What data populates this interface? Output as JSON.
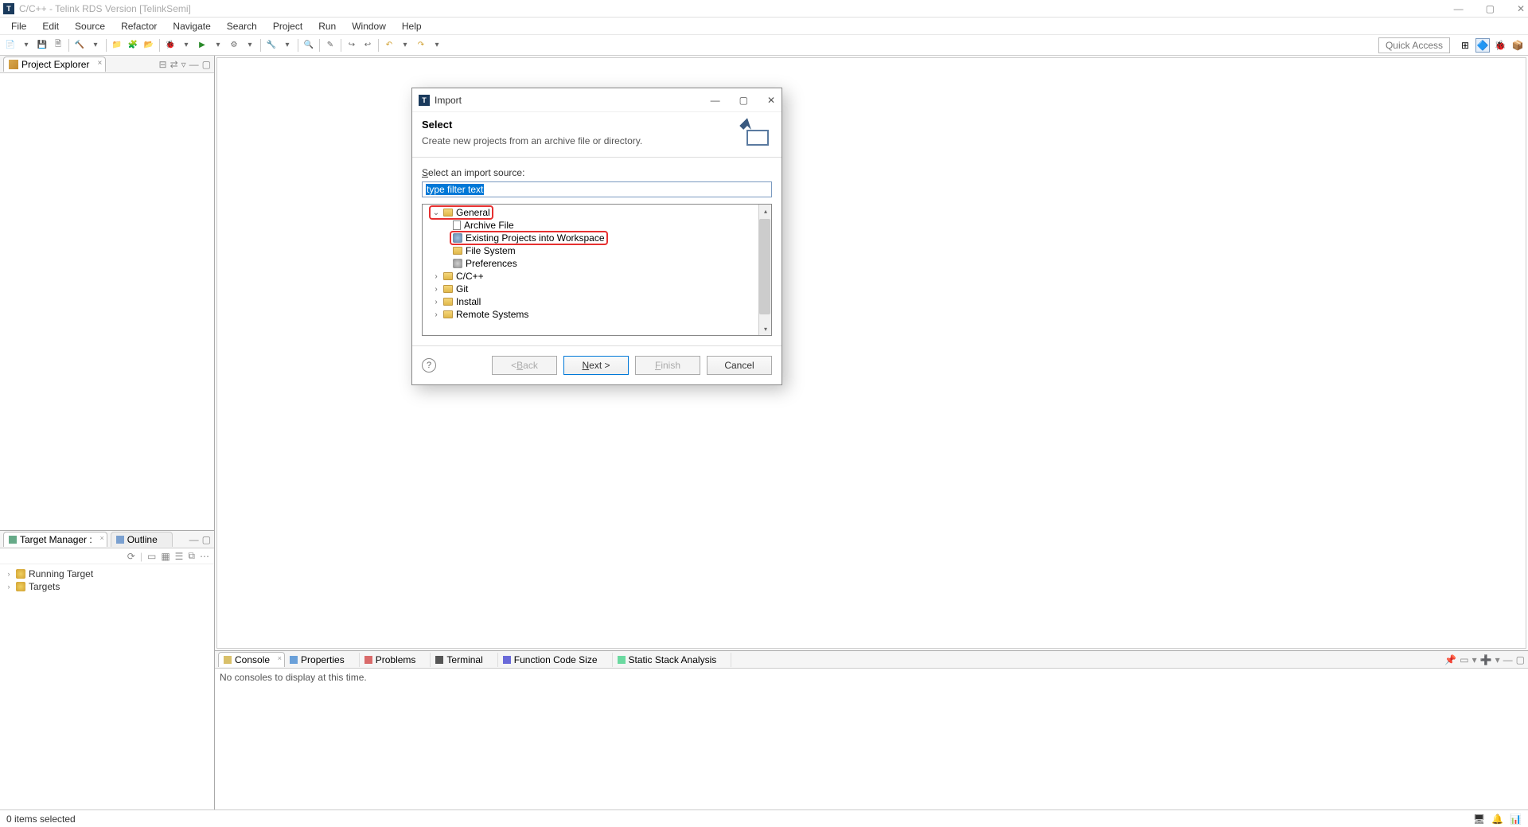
{
  "window": {
    "title": "C/C++ - Telink RDS Version [TelinkSemi]",
    "app_icon_letter": "T"
  },
  "menu": {
    "file": "File",
    "edit": "Edit",
    "source": "Source",
    "refactor": "Refactor",
    "navigate": "Navigate",
    "search": "Search",
    "project": "Project",
    "run": "Run",
    "window": "Window",
    "help": "Help"
  },
  "toolbar": {
    "quick_access": "Quick Access"
  },
  "project_explorer": {
    "title": "Project Explorer"
  },
  "target_manager": {
    "tab1": "Target Manager :",
    "tab2": "Outline",
    "nodes": {
      "running": "Running Target",
      "targets": "Targets"
    }
  },
  "bottom_tabs": {
    "console": "Console",
    "properties": "Properties",
    "problems": "Problems",
    "terminal": "Terminal",
    "func_code_size": "Function Code Size",
    "static_stack": "Static Stack Analysis"
  },
  "console_body": "No consoles to display at this time.",
  "statusbar": {
    "text": "0 items selected"
  },
  "dialog": {
    "title": "Import",
    "heading": "Select",
    "subheading": "Create new projects from an archive file or directory.",
    "section_label": "Select an import source:",
    "filter_text": "type filter text",
    "tree": {
      "general": "General",
      "archive_file": "Archive File",
      "existing_projects": "Existing Projects into Workspace",
      "file_system": "File System",
      "preferences": "Preferences",
      "cpp": "C/C++",
      "git": "Git",
      "install": "Install",
      "remote": "Remote Systems"
    },
    "buttons": {
      "back": "< Back",
      "next": "Next >",
      "finish": "Finish",
      "cancel": "Cancel"
    }
  }
}
